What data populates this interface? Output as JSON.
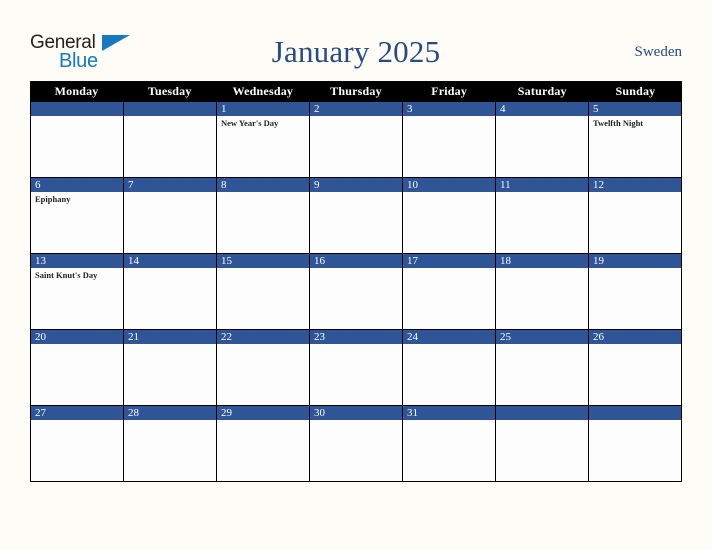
{
  "brand": {
    "name_part1": "General",
    "name_part2": "Blue",
    "triangle_icon": "triangle-icon",
    "color_dark": "#231f20",
    "color_blue": "#1878c0"
  },
  "header": {
    "title": "January 2025",
    "region": "Sweden",
    "title_color": "#2b4a7d"
  },
  "calendar": {
    "accent_color": "#2f5597",
    "header_bg": "#000000",
    "weekdays": [
      "Monday",
      "Tuesday",
      "Wednesday",
      "Thursday",
      "Friday",
      "Saturday",
      "Sunday"
    ],
    "weeks": [
      [
        {
          "date": "",
          "events": []
        },
        {
          "date": "",
          "events": []
        },
        {
          "date": "1",
          "events": [
            "New Year's Day"
          ]
        },
        {
          "date": "2",
          "events": []
        },
        {
          "date": "3",
          "events": []
        },
        {
          "date": "4",
          "events": []
        },
        {
          "date": "5",
          "events": [
            "Twelfth Night"
          ]
        }
      ],
      [
        {
          "date": "6",
          "events": [
            "Epiphany"
          ]
        },
        {
          "date": "7",
          "events": []
        },
        {
          "date": "8",
          "events": []
        },
        {
          "date": "9",
          "events": []
        },
        {
          "date": "10",
          "events": []
        },
        {
          "date": "11",
          "events": []
        },
        {
          "date": "12",
          "events": []
        }
      ],
      [
        {
          "date": "13",
          "events": [
            "Saint Knut's Day"
          ]
        },
        {
          "date": "14",
          "events": []
        },
        {
          "date": "15",
          "events": []
        },
        {
          "date": "16",
          "events": []
        },
        {
          "date": "17",
          "events": []
        },
        {
          "date": "18",
          "events": []
        },
        {
          "date": "19",
          "events": []
        }
      ],
      [
        {
          "date": "20",
          "events": []
        },
        {
          "date": "21",
          "events": []
        },
        {
          "date": "22",
          "events": []
        },
        {
          "date": "23",
          "events": []
        },
        {
          "date": "24",
          "events": []
        },
        {
          "date": "25",
          "events": []
        },
        {
          "date": "26",
          "events": []
        }
      ],
      [
        {
          "date": "27",
          "events": []
        },
        {
          "date": "28",
          "events": []
        },
        {
          "date": "29",
          "events": []
        },
        {
          "date": "30",
          "events": []
        },
        {
          "date": "31",
          "events": []
        },
        {
          "date": "",
          "events": []
        },
        {
          "date": "",
          "events": []
        }
      ]
    ]
  }
}
